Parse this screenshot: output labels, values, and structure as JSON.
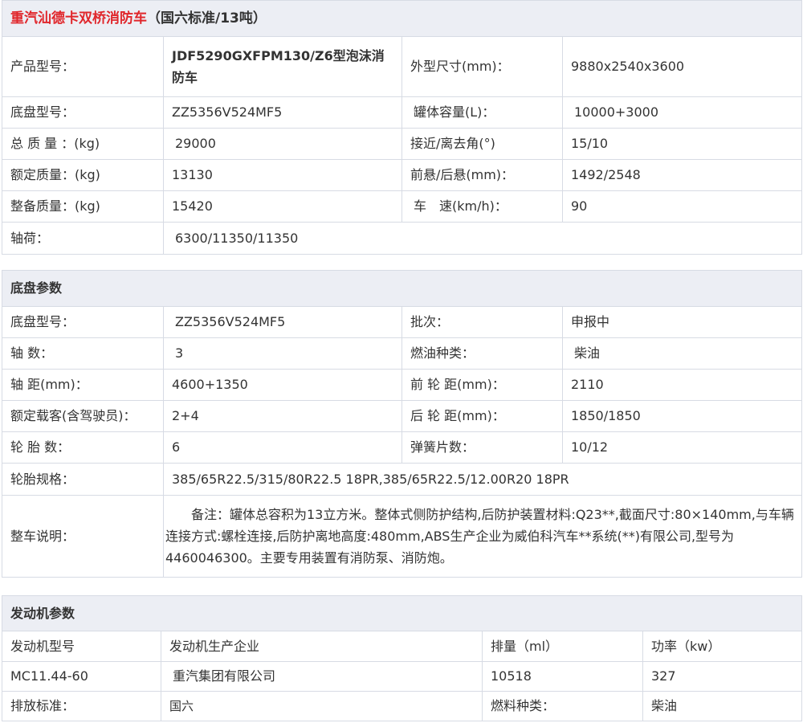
{
  "title": {
    "red": "重汽汕德卡双桥消防车",
    "black": "（国六标准/13吨）"
  },
  "product": [
    [
      "产品型号：",
      "JDF5290GXFPM130/Z6型泡沫消防车",
      "外型尺寸(mm)：",
      "9880x2540x3600"
    ],
    [
      "底盘型号：",
      "ZZ5356V524MF5",
      "罐体容量(L)：",
      "10000+3000"
    ],
    [
      "总 质 量 ：(kg)",
      "29000",
      "接近/离去角(°)",
      "15/10"
    ],
    [
      "额定质量：(kg)",
      "13130",
      "前悬/后悬(mm)：",
      "1492/2548"
    ],
    [
      "整备质量：(kg)",
      "15420",
      "车　速(km/h)：",
      "90"
    ]
  ],
  "axle_load": {
    "label": "轴荷：",
    "value": "6300/11350/11350"
  },
  "chassis": {
    "title": "底盘参数",
    "rows": [
      [
        "底盘型号：",
        "ZZ5356V524MF5",
        "批次：",
        "申报中"
      ],
      [
        "轴 数：",
        "3",
        "燃油种类：",
        "柴油"
      ],
      [
        "轴 距(mm)：",
        "4600+1350",
        "前 轮 距(mm)：",
        "2110"
      ],
      [
        "额定载客(含驾驶员)：",
        "2+4",
        "后 轮 距(mm)：",
        "1850/1850"
      ],
      [
        "轮 胎 数：",
        "6",
        "弹簧片数：",
        "10/12"
      ]
    ],
    "tire_spec": {
      "label": "轮胎规格：",
      "value": "385/65R22.5/315/80R22.5 18PR,385/65R22.5/12.00R20 18PR"
    },
    "description": {
      "label": "整车说明：",
      "text": "备注：罐体总容积为13立方米。整体式侧防护结构,后防护装置材料:Q23**,截面尺寸:80×140mm,与车辆连接方式:螺栓连接,后防护离地高度:480mm,ABS生产企业为威伯科汽车**系统(**)有限公司,型号为4460046300。主要专用装置有消防泵、消防炮。"
    }
  },
  "engine": {
    "title": "发动机参数",
    "headers": [
      "发动机型号",
      "发动机生产企业",
      "排量（ml）",
      "功率（kw）"
    ],
    "row": [
      "MC11.44-60",
      "重汽集团有限公司",
      "10518",
      "327"
    ],
    "emission": [
      "排放标准：",
      "国六",
      "燃料种类：",
      "柴油"
    ]
  }
}
